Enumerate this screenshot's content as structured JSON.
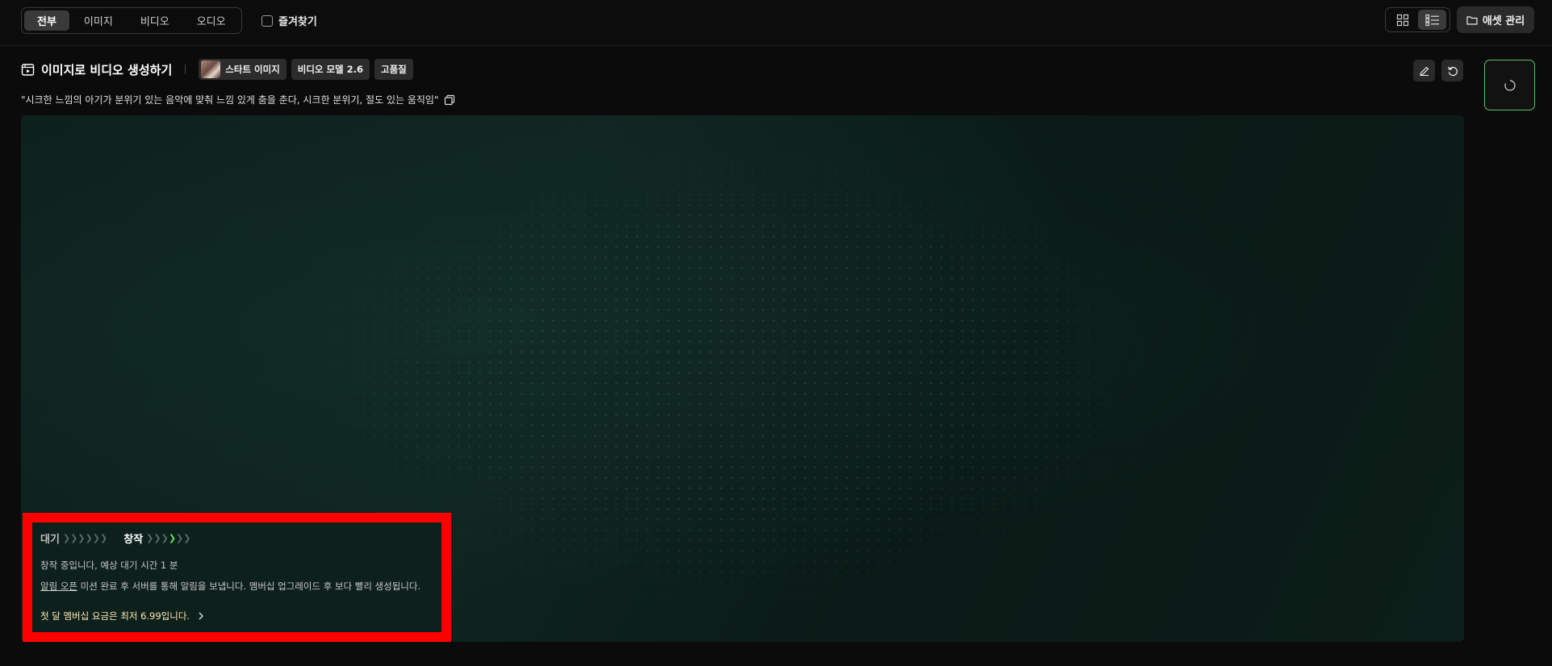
{
  "filters": {
    "tabs": [
      {
        "label": "전부",
        "active": true
      },
      {
        "label": "이미지",
        "active": false
      },
      {
        "label": "비디오",
        "active": false
      },
      {
        "label": "오디오",
        "active": false
      }
    ],
    "favorites_label": "즐겨찾기",
    "favorites_checked": false
  },
  "toolbar": {
    "asset_manage_label": "애셋 관리",
    "view_modes": [
      "grid-view-icon",
      "list-view-icon"
    ],
    "active_view": "list"
  },
  "task": {
    "title": "이미지로 비디오 생성하기",
    "chips": [
      "스타트 이미지",
      "비디오 모델 2.6",
      "고품질"
    ],
    "prompt": "\"시크한 느낌의 아기가 분위기 있는 음악에 맞춰 느낌 있게 춤을 춘다, 시크한 분위기, 절도 있는 움직임\""
  },
  "status": {
    "step_wait": "대기",
    "step_create": "창작",
    "wait_chevrons": "❯❯❯❯❯❯",
    "create_chevrons_before": "❯❯❯",
    "create_chevron_active": "❯",
    "create_chevrons_after": "❯❯",
    "progress_message": "창작 중입니다, 예상 대기 시간 1 분",
    "notify_link": "알림 오픈",
    "notify_message": " 미션 완료 후 서버를 통해 알림을 보냅니다. 멤버십 업그레이드 후 보다 빨리 생성됩니다.",
    "membership_offer": "첫 달 멤버십 요금은 최저 6.99입니다."
  },
  "colors": {
    "accent_green": "#5ec25e",
    "highlight_red": "#ff0000",
    "offer_text": "#ffe9b0"
  }
}
